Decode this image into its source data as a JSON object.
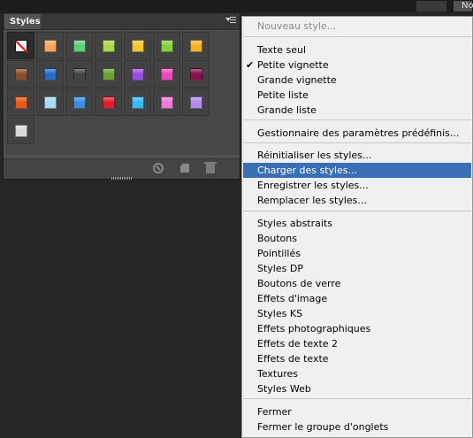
{
  "topbar": {
    "right_button_label": "No"
  },
  "panel": {
    "tab_label": "Styles",
    "swatches": [
      "none",
      "#f5a85a",
      "#5fd07a",
      "#a8d84a",
      "#f2c532",
      "#88d040",
      "#f6b12a",
      "#8a4f2a",
      "#2a6dc9",
      "#444444",
      "#6e9e3a",
      "#9a4fe0",
      "#e64ab8",
      "#8a1050",
      "#e85a14",
      "#a8dcf8",
      "#3a8fe0",
      "#e0202a",
      "#38b8f0",
      "#f078d8",
      "#b38ce8",
      "#d8d8d8"
    ]
  },
  "menu": {
    "new_style": "Nouveau style...",
    "view_items": [
      "Texte seul",
      "Petite vignette",
      "Grande vignette",
      "Petite liste",
      "Grande liste"
    ],
    "checked_view": "Petite vignette",
    "preset_manager": "Gestionnaire des paramètres prédéfinis...",
    "file_items": [
      "Réinitialiser les styles...",
      "Charger des styles...",
      "Enregistrer les styles...",
      "Remplacer les styles..."
    ],
    "highlighted_item": "Charger des styles...",
    "library_items": [
      "Styles abstraits",
      "Boutons",
      "Pointillés",
      "Styles DP",
      "Boutons de verre",
      "Effets d'image",
      "Styles KS",
      "Effets photographiques",
      "Effets de texte 2",
      "Effets de texte",
      "Textures",
      "Styles Web"
    ],
    "close_items": [
      "Fermer",
      "Fermer le groupe d'onglets"
    ]
  }
}
